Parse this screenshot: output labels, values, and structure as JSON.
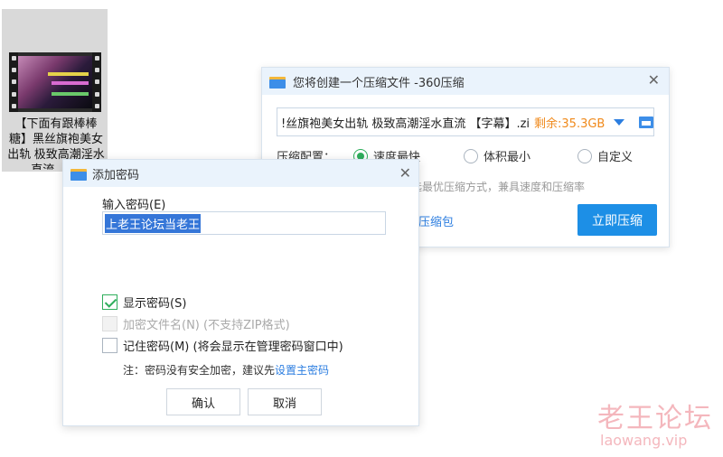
{
  "desktop_file": {
    "name": "【下面有跟棒棒糖】黑丝旗袍美女出轨 极致高潮淫水直流 【字"
  },
  "compress_window": {
    "title": "您将创建一个压缩文件 -360压缩",
    "path": "!丝旗袍美女出轨 极致高潮淫水直流 【字幕】.zip",
    "free_space": "剩余:35.3GB",
    "config_label": "压缩配置：",
    "options": [
      "速度最快",
      "体积最小",
      "自定义"
    ],
    "selected_option": "速度最快",
    "hint": "选最优压缩方式，兼具速度和压缩率",
    "package_link": "压缩包",
    "compress_button": "立即压缩"
  },
  "password_dialog": {
    "title": "添加密码",
    "enter_label": "输入密码(E)",
    "password_value": "上老王论坛当老王",
    "show_password": {
      "label": "显示密码(S)",
      "checked": true
    },
    "encrypt_names": {
      "label": "加密文件名(N) (不支持ZIP格式)",
      "checked": false,
      "disabled": true
    },
    "remember": {
      "label": "记住密码(M) (将会显示在管理密码窗口中)",
      "checked": false
    },
    "note_prefix": "注：密码没有安全加密，建议先",
    "note_link": "设置主密码",
    "ok_button": "确认",
    "cancel_button": "取消"
  },
  "watermark": {
    "line1": "老王论坛",
    "line2": "laowang.vip"
  },
  "colors": {
    "accent": "#1d8fe6",
    "check_green": "#2fae5c",
    "free_space_orange": "#f08a1c",
    "titlebar": "#eaf3fc"
  }
}
